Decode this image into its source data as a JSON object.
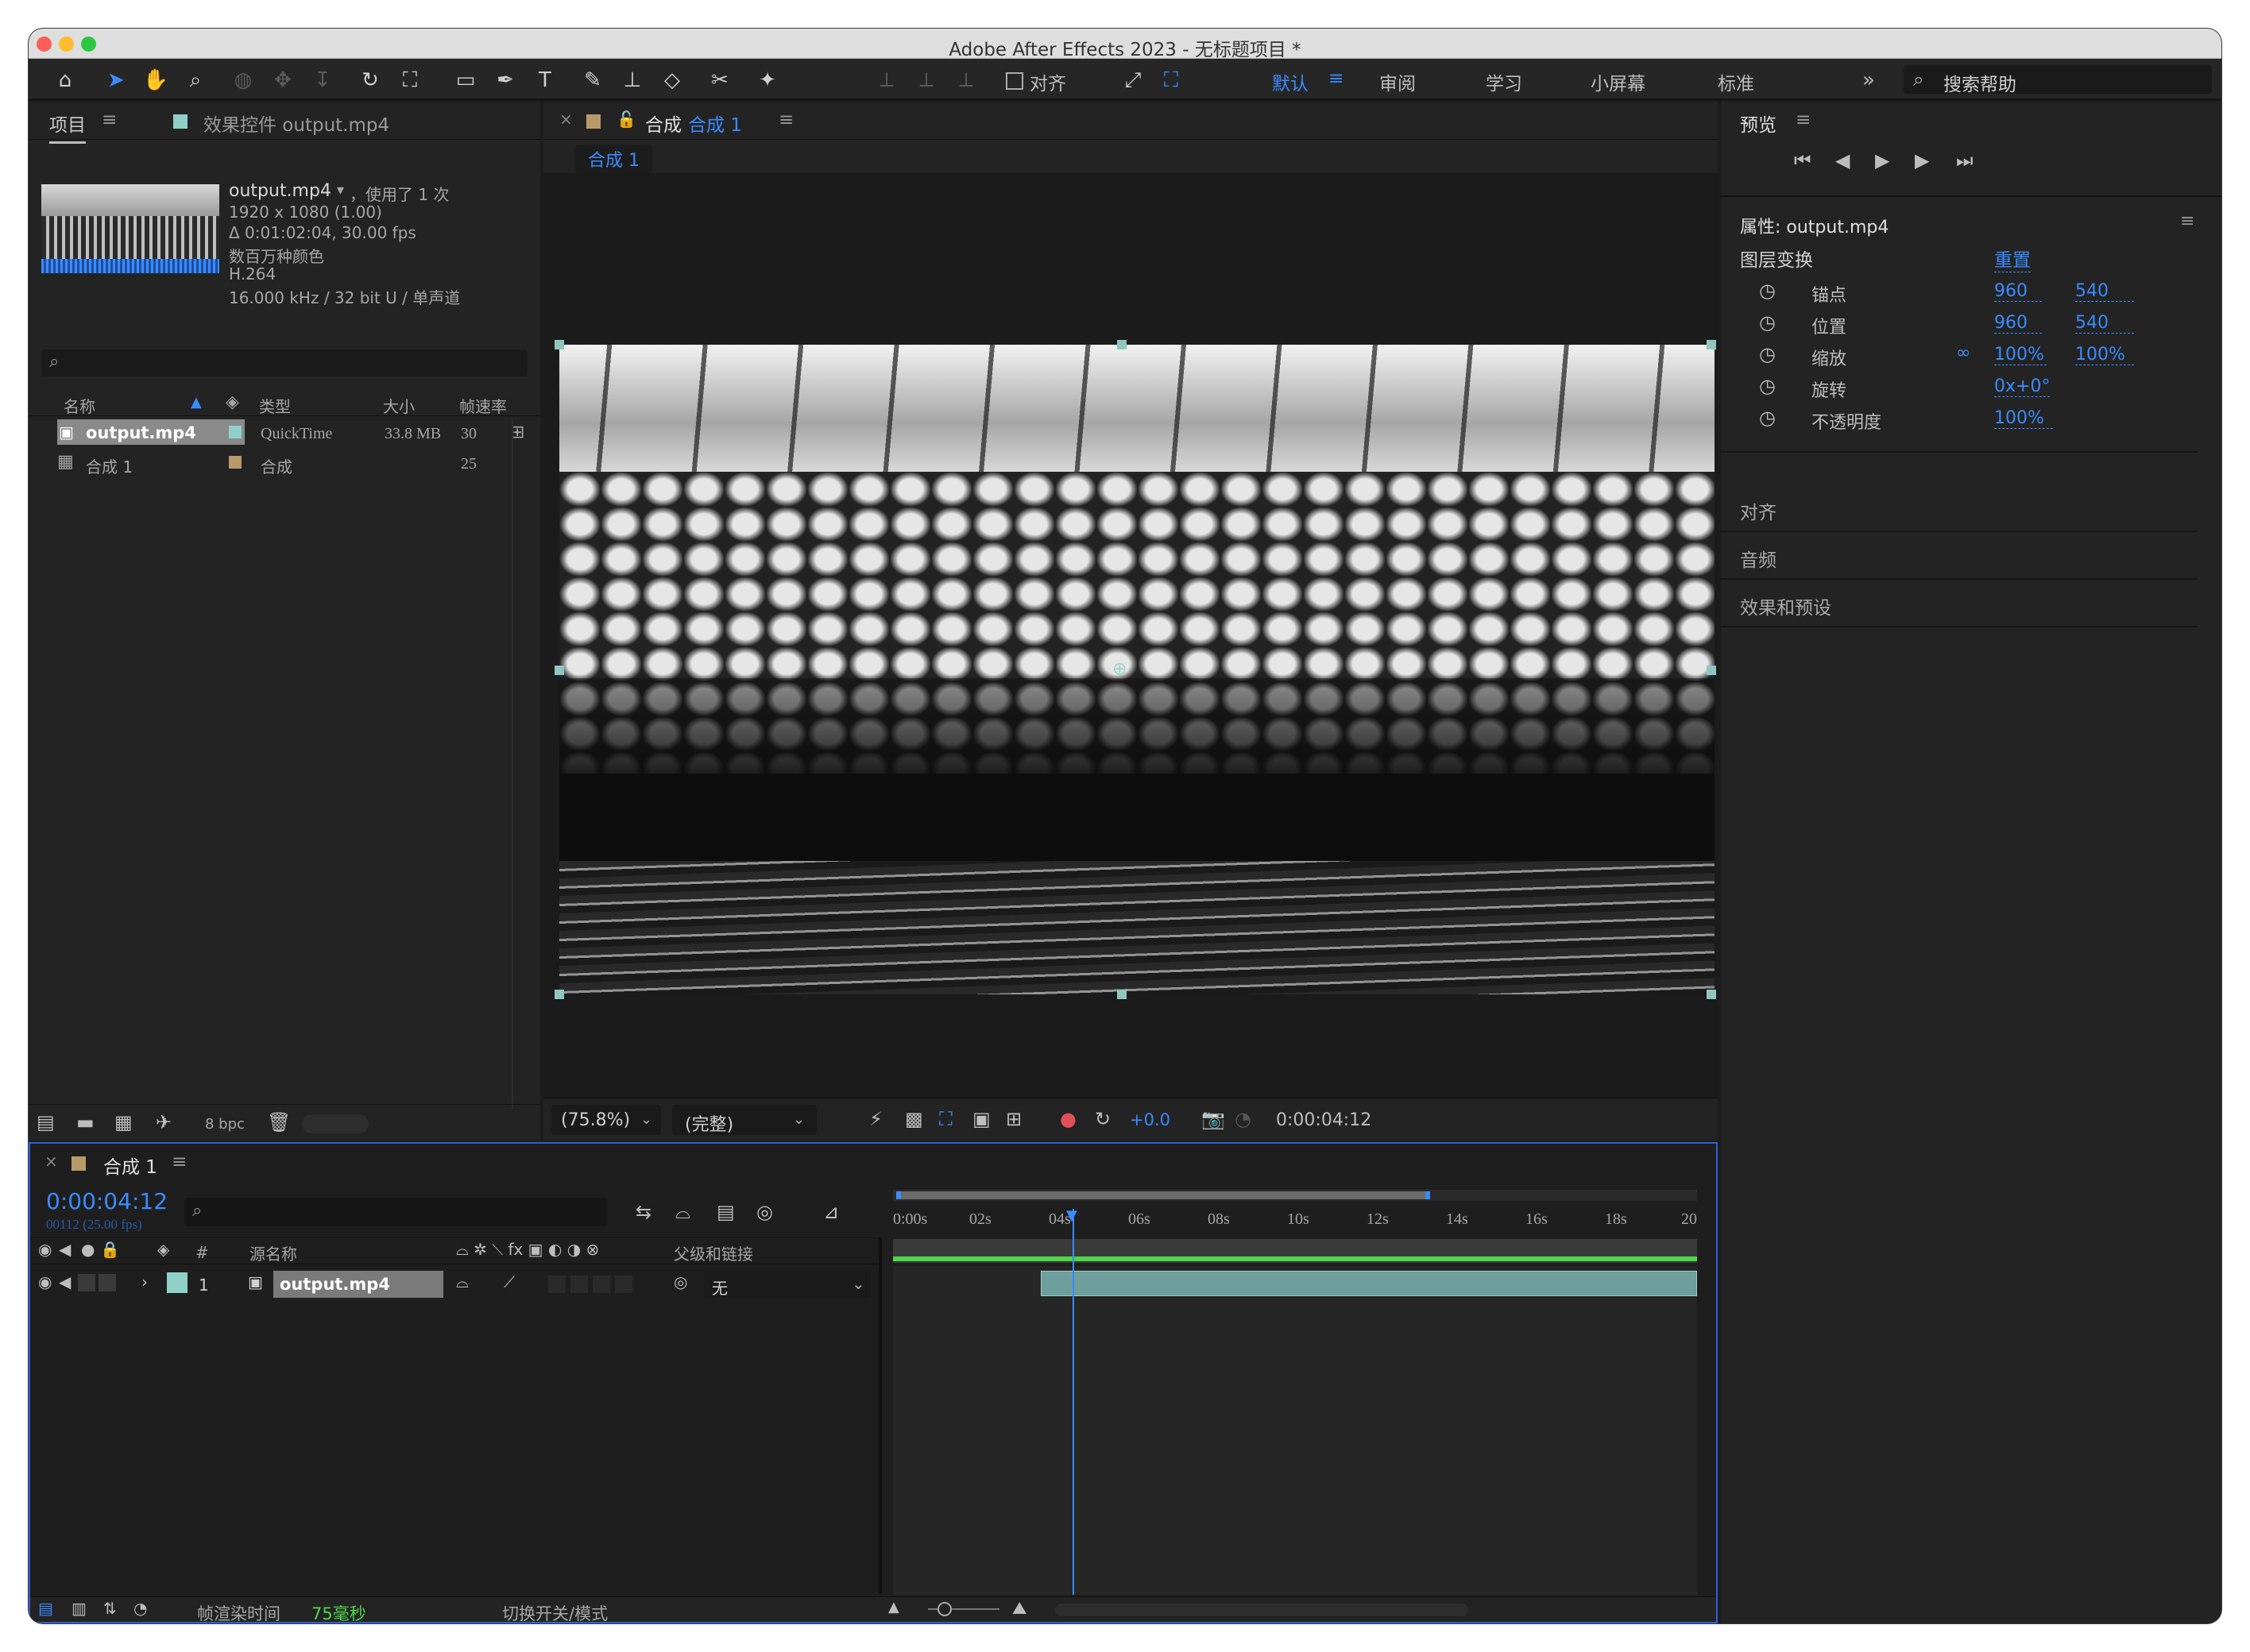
{
  "window": {
    "title": "Adobe After Effects 2023 - 无标题项目 *"
  },
  "toolbar": {
    "align_label": "对齐",
    "workspaces": [
      "默认",
      "审阅",
      "学习",
      "小屏幕",
      "标准"
    ],
    "search_placeholder": "搜索帮助",
    "overflow": "»"
  },
  "project": {
    "tab_label": "项目",
    "effects_tab": "效果控件 output.mp4",
    "info": {
      "name": "output.mp4",
      "used": "，使用了 1 次",
      "dims": "1920 x 1080 (1.00)",
      "duration": "Δ 0:01:02:04, 30.00 fps",
      "colors": "数百万种颜色",
      "codec": "H.264",
      "audio": "16.000 kHz / 32 bit U / 单声道"
    },
    "columns": {
      "name": "名称",
      "type": "类型",
      "size": "大小",
      "fps": "帧速率"
    },
    "items": [
      {
        "name": "output.mp4",
        "type": "QuickTime",
        "size": "33.8 MB",
        "fps": "30"
      },
      {
        "name": "合成 1",
        "type": "合成",
        "size": "",
        "fps": "25"
      }
    ],
    "bpc": "8 bpc"
  },
  "comp": {
    "tab_label": "合成",
    "tab_name": "合成 1",
    "breadcrumb": "合成 1",
    "zoom": "(75.8%)",
    "quality": "(完整)",
    "exposure": "+0.0",
    "timecode": "0:00:04:12"
  },
  "preview": {
    "title": "预览"
  },
  "properties": {
    "title": "属性: output.mp4",
    "section": "图层变换",
    "reset": "重置",
    "rows": [
      {
        "label": "锚点",
        "v1": "960",
        "v2": "540"
      },
      {
        "label": "位置",
        "v1": "960",
        "v2": "540"
      },
      {
        "label": "缩放",
        "v1": "100%",
        "v2": "100%"
      },
      {
        "label": "旋转",
        "v1": "0x+0°",
        "v2": ""
      },
      {
        "label": "不透明度",
        "v1": "100%",
        "v2": ""
      }
    ],
    "panels": [
      "对齐",
      "音频",
      "效果和预设"
    ]
  },
  "timeline": {
    "tab_name": "合成 1",
    "timecode": "0:00:04:12",
    "frame_info": "00112 (25.00 fps)",
    "col_source": "源名称",
    "col_parent": "父级和链接",
    "col_num": "#",
    "layer": {
      "num": "1",
      "name": "output.mp4",
      "parent": "无"
    },
    "ruler": [
      "0:00s",
      "02s",
      "04s",
      "06s",
      "08s",
      "10s",
      "12s",
      "14s",
      "16s",
      "18s",
      "20"
    ],
    "render_label": "帧渲染时间",
    "render_value": "75毫秒",
    "toggle_label": "切换开关/模式"
  },
  "colors": {
    "accent": "#3a8bff",
    "clip": "#6d9f9d",
    "render_green": "#4fd64a",
    "label_tan": "#b89a6a",
    "label_teal": "#8ed0c8"
  }
}
